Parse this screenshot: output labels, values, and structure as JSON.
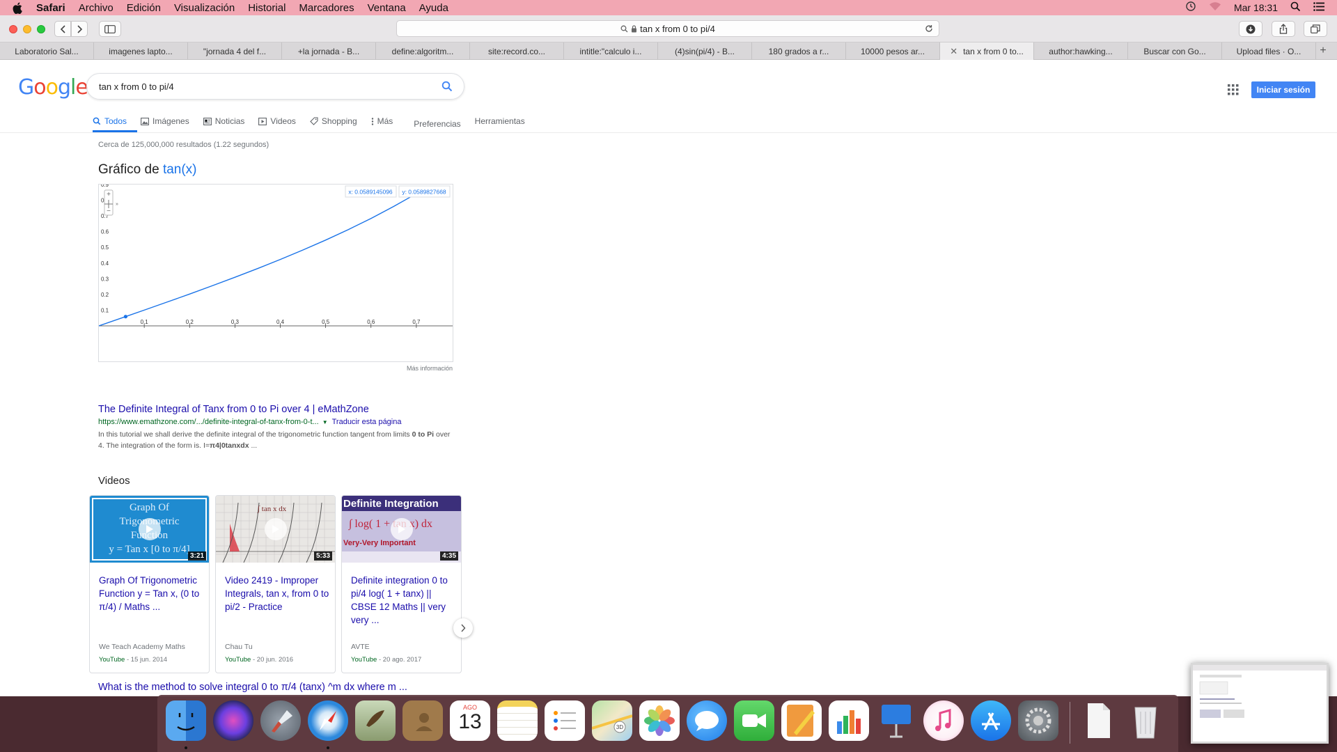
{
  "menubar": {
    "app": "Safari",
    "items": [
      "Archivo",
      "Edición",
      "Visualización",
      "Historial",
      "Marcadores",
      "Ventana",
      "Ayuda"
    ],
    "clock": "Mar 18:31"
  },
  "toolbar": {
    "address": "tan x from 0 to pi/4"
  },
  "tabs": [
    {
      "label": "Laboratorio Sal..."
    },
    {
      "label": "imagenes lapto..."
    },
    {
      "label": "\"jornada 4 del f..."
    },
    {
      "label": "+la jornada - B..."
    },
    {
      "label": "define:algoritm..."
    },
    {
      "label": "site:record.co..."
    },
    {
      "label": "intitle:\"calculo i..."
    },
    {
      "label": "(4)sin(pi/4) - B..."
    },
    {
      "label": "180 grados a r..."
    },
    {
      "label": "10000 pesos ar..."
    },
    {
      "label": "tan x from 0 to...",
      "active": true
    },
    {
      "label": "author:hawking..."
    },
    {
      "label": "Buscar con Go..."
    },
    {
      "label": "Upload files · O..."
    }
  ],
  "google": {
    "logo": "Google",
    "query": "tan x from 0 to pi/4",
    "signin": "Iniciar sesión",
    "nav": [
      {
        "label": "Todos",
        "icon": "search-icon",
        "active": true
      },
      {
        "label": "Imágenes",
        "icon": "image-icon"
      },
      {
        "label": "Noticias",
        "icon": "news-icon"
      },
      {
        "label": "Videos",
        "icon": "video-icon"
      },
      {
        "label": "Shopping",
        "icon": "tag-icon"
      },
      {
        "label": "Más",
        "icon": "more-icon"
      },
      {
        "label": "Preferencias"
      },
      {
        "label": "Herramientas"
      }
    ],
    "stats": "Cerca de 125,000,000 resultados (1.22 segundos)"
  },
  "graph": {
    "title_prefix": "Gráfico de",
    "title_func": "tan(x)",
    "readout_x": "x: 0.0589145096",
    "readout_y": "y: 0.0589827668",
    "more_info": "Más información"
  },
  "chart_data": {
    "type": "line",
    "series": [
      {
        "x": [
          0,
          0.05,
          0.1,
          0.15,
          0.2,
          0.25,
          0.3,
          0.35,
          0.4,
          0.45,
          0.5,
          0.55,
          0.6,
          0.65,
          0.69
        ],
        "y": [
          0,
          0.05,
          0.1003,
          0.1511,
          0.2027,
          0.2553,
          0.3093,
          0.365,
          0.4228,
          0.4831,
          0.5463,
          0.6131,
          0.6841,
          0.7602,
          0.8253
        ]
      }
    ],
    "point": {
      "x": 0.0589145096,
      "y": 0.0589827668
    },
    "xticks": [
      "0.1",
      "0.2",
      "0.3",
      "0.4",
      "0.5",
      "0.6",
      "0.7"
    ],
    "yticks": [
      "0.1",
      "0.2",
      "0.3",
      "0.4",
      "0.5",
      "0.6",
      "0.7",
      "0.8",
      "0.9"
    ],
    "xlim": [
      0,
      0.78
    ],
    "ylim": [
      0,
      0.9
    ],
    "line_color": "#1a73e8",
    "grid": false
  },
  "result1": {
    "title": "The Definite Integral of Tanx from 0 to Pi over 4 | eMathZone",
    "url": "https://www.emathzone.com/.../definite-integral-of-tanx-from-0-t...",
    "translate": "Traducir esta página",
    "snippet_a": "In this tutorial we shall derive the definite integral of the trigonometric function tangent from limits ",
    "snippet_bold1": "0 to Pi",
    "snippet_b": " over 4. The integration of the form is. I=",
    "snippet_bold2": "π4|0tanxdx",
    "snippet_c": " ..."
  },
  "videos": {
    "heading": "Videos",
    "items": [
      {
        "thumb_lines": [
          "Graph Of",
          "Trigonometric",
          "Function",
          "y = Tan x [0 to π/4]"
        ],
        "duration": "3:21",
        "title": "Graph Of Trigonometric Function y = Tan x, (0 to π/4) / Maths ...",
        "channel": "We Teach Academy Maths",
        "source": "YouTube",
        "date": " - 15 jun. 2014"
      },
      {
        "thumb_lines": [],
        "duration": "5:33",
        "title": "Video 2419 - Improper Integrals, tan x, from 0 to pi/2 - Practice",
        "channel": "Chau Tu",
        "source": "YouTube",
        "date": " - 20 jun. 2016"
      },
      {
        "thumb_lines": [
          "Definite Integration",
          "∫ log( 1 + tan x) dx",
          "Very-Very Important"
        ],
        "duration": "4:35",
        "title": "Definite integration 0 to pi/4 log( 1 + tanx) || CBSE 12 Maths || very very ...",
        "channel": "AVTE",
        "source": "YouTube",
        "date": " - 20 ago. 2017"
      }
    ]
  },
  "result2": {
    "title": "What is the method to solve integral 0 to π/4 (tanx) ^m dx where m ..."
  },
  "dock": {
    "calendar_month": "AGO",
    "calendar_day": "13"
  }
}
